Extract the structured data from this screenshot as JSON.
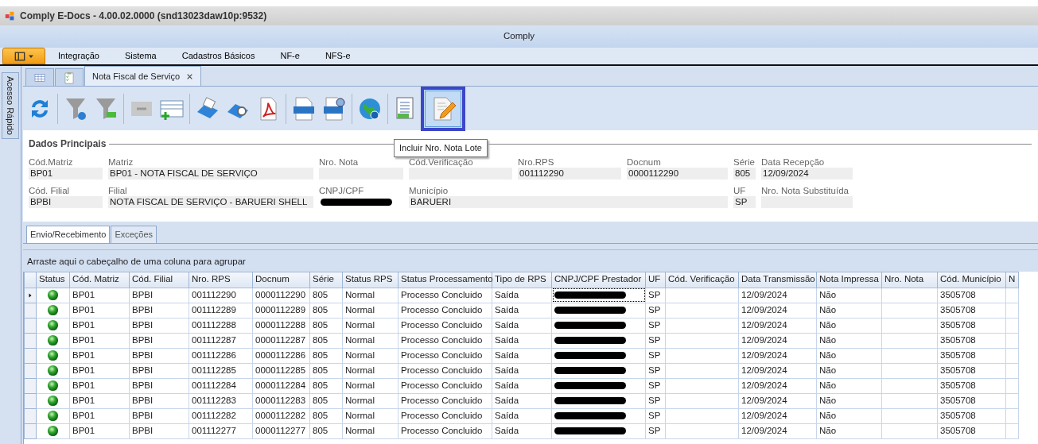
{
  "window": {
    "title": "Comply E-Docs - 4.00.02.0000 (snd13023daw10p:9532)"
  },
  "ribbon_title": "Comply",
  "menu": [
    "Integração",
    "Sistema",
    "Cadastros Básicos",
    "NF-e",
    "NFS-e"
  ],
  "side_panel": {
    "label": "Acesso Rápido"
  },
  "doc_tabs": [
    {
      "kind": "grid",
      "selected": false
    },
    {
      "kind": "checklist",
      "selected": false
    },
    {
      "kind": "text",
      "label": "Nota Fiscal de Serviço",
      "selected": true
    }
  ],
  "toolbar": [
    {
      "kind": "refresh",
      "selected": false
    },
    {
      "kind": "sep"
    },
    {
      "kind": "filter",
      "selected": false
    },
    {
      "kind": "filter-clear",
      "selected": false
    },
    {
      "kind": "sep"
    },
    {
      "kind": "reload",
      "selected": false
    },
    {
      "kind": "add-row",
      "selected": false
    },
    {
      "kind": "sep"
    },
    {
      "kind": "print",
      "selected": false
    },
    {
      "kind": "print-preview",
      "selected": false
    },
    {
      "kind": "pdf",
      "selected": false
    },
    {
      "kind": "sep"
    },
    {
      "kind": "xml",
      "selected": false
    },
    {
      "kind": "xml-search",
      "selected": false
    },
    {
      "kind": "sep"
    },
    {
      "kind": "globe",
      "selected": false
    },
    {
      "kind": "sep"
    },
    {
      "kind": "doc-add",
      "selected": false
    },
    {
      "kind": "edit",
      "selected": true
    }
  ],
  "tooltip": "Incluir Nro. Nota Lote",
  "form": {
    "title": "Dados Principais",
    "rows": [
      [
        {
          "label": "Cód.Matriz",
          "value": "BP01"
        },
        {
          "label": "Matriz",
          "value": "BP01 - NOTA FISCAL DE SERVIÇO"
        },
        {
          "label": "Nro. Nota"
        },
        {
          "label": "Cód.Verificação"
        },
        {
          "label": "Nro.RPS",
          "value": "001112290"
        },
        {
          "label": "Docnum",
          "value": "0000112290"
        },
        {
          "label": "Série",
          "value": "805"
        },
        {
          "label": "Data Recepção",
          "value": "12/09/2024"
        }
      ],
      [
        {
          "label": "Cód. Filial",
          "value": "BPBI"
        },
        {
          "label": "Filial",
          "value": "NOTA FISCAL DE SERVIÇO - BARUERI SHELL"
        },
        {
          "label": "CNPJ/CPF",
          "redacted": true
        },
        {
          "label": "Município",
          "value": "BARUERI"
        },
        "",
        "",
        {
          "label": "UF",
          "value": "SP"
        },
        {
          "label": "Nro. Nota Substituída"
        }
      ]
    ]
  },
  "sub_tabs": [
    {
      "label": "Envio/Recebimento",
      "selected": true
    },
    {
      "label": "Exceções",
      "selected": false
    }
  ],
  "group_panel": "Arraste aqui o cabeçalho de uma coluna para agrupar",
  "table": {
    "columns": [
      "Status",
      "Cód. Matriz",
      "Cód. Filial",
      "Nro. RPS",
      "Docnum",
      "Série",
      "Status RPS",
      "Status Processamento",
      "Tipo de RPS",
      "CNPJ/CPF Prestador",
      "UF",
      "Cód. Verificação",
      "Data Transmissão",
      "Nota Impressa",
      "Nro. Nota",
      "Cód. Município",
      "N"
    ],
    "rows": [
      {
        "selected": true,
        "status_ok": true,
        "cells": [
          "",
          "BP01",
          "BPBI",
          "001112290",
          "0000112290",
          "805",
          "Normal",
          "Processo Concluido",
          "Saída",
          null,
          "SP",
          "",
          "12/09/2024",
          "Não",
          "",
          "3505708",
          ""
        ]
      },
      {
        "selected": false,
        "status_ok": true,
        "cells": [
          "",
          "BP01",
          "BPBI",
          "001112289",
          "0000112289",
          "805",
          "Normal",
          "Processo Concluido",
          "Saída",
          null,
          "SP",
          "",
          "12/09/2024",
          "Não",
          "",
          "3505708",
          ""
        ]
      },
      {
        "selected": false,
        "status_ok": true,
        "cells": [
          "",
          "BP01",
          "BPBI",
          "001112288",
          "0000112288",
          "805",
          "Normal",
          "Processo Concluido",
          "Saída",
          null,
          "SP",
          "",
          "12/09/2024",
          "Não",
          "",
          "3505708",
          ""
        ]
      },
      {
        "selected": false,
        "status_ok": true,
        "cells": [
          "",
          "BP01",
          "BPBI",
          "001112287",
          "0000112287",
          "805",
          "Normal",
          "Processo Concluido",
          "Saída",
          null,
          "SP",
          "",
          "12/09/2024",
          "Não",
          "",
          "3505708",
          ""
        ]
      },
      {
        "selected": false,
        "status_ok": true,
        "cells": [
          "",
          "BP01",
          "BPBI",
          "001112286",
          "0000112286",
          "805",
          "Normal",
          "Processo Concluido",
          "Saída",
          null,
          "SP",
          "",
          "12/09/2024",
          "Não",
          "",
          "3505708",
          ""
        ]
      },
      {
        "selected": false,
        "status_ok": true,
        "cells": [
          "",
          "BP01",
          "BPBI",
          "001112285",
          "0000112285",
          "805",
          "Normal",
          "Processo Concluido",
          "Saída",
          null,
          "SP",
          "",
          "12/09/2024",
          "Não",
          "",
          "3505708",
          ""
        ]
      },
      {
        "selected": false,
        "status_ok": true,
        "cells": [
          "",
          "BP01",
          "BPBI",
          "001112284",
          "0000112284",
          "805",
          "Normal",
          "Processo Concluido",
          "Saída",
          null,
          "SP",
          "",
          "12/09/2024",
          "Não",
          "",
          "3505708",
          ""
        ]
      },
      {
        "selected": false,
        "status_ok": true,
        "cells": [
          "",
          "BP01",
          "BPBI",
          "001112283",
          "0000112283",
          "805",
          "Normal",
          "Processo Concluido",
          "Saída",
          null,
          "SP",
          "",
          "12/09/2024",
          "Não",
          "",
          "3505708",
          ""
        ]
      },
      {
        "selected": false,
        "status_ok": true,
        "cells": [
          "",
          "BP01",
          "BPBI",
          "001112282",
          "0000112282",
          "805",
          "Normal",
          "Processo Concluido",
          "Saída",
          null,
          "SP",
          "",
          "12/09/2024",
          "Não",
          "",
          "3505708",
          ""
        ]
      },
      {
        "selected": false,
        "status_ok": true,
        "cells": [
          "",
          "BP01",
          "BPBI",
          "001112277",
          "0000112277",
          "805",
          "Normal",
          "Processo Concluido",
          "Saída",
          null,
          "SP",
          "",
          "12/09/2024",
          "Não",
          "",
          "3505708",
          ""
        ]
      }
    ]
  }
}
